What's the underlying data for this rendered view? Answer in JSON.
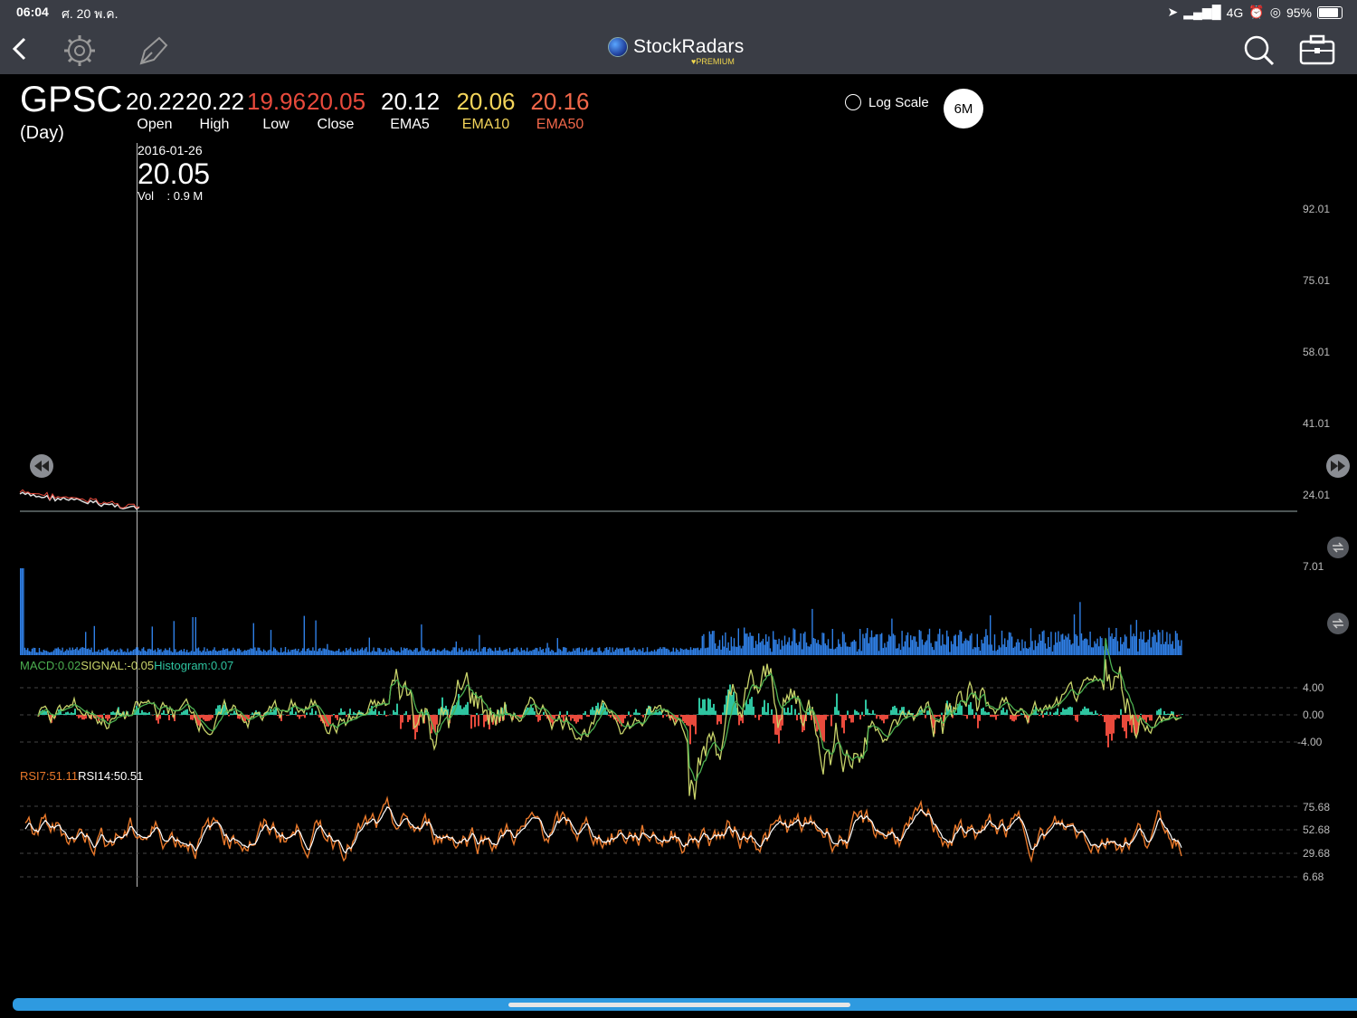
{
  "status": {
    "time": "06:04",
    "date": "ศ. 20 พ.ค.",
    "network": "4G",
    "battery": "95%",
    "battery_level": 0.95
  },
  "nav": {
    "brand": "StockRadars",
    "brand_sub": "PREMIUM"
  },
  "header": {
    "symbol": "GPSC",
    "period": "(Day)",
    "quote": [
      {
        "value": "20.22",
        "label": "Open",
        "color": "#ffffff"
      },
      {
        "value": "20.22",
        "label": "High",
        "color": "#ffffff"
      },
      {
        "value": "19.96",
        "label": "Low",
        "color": "#e84a3c"
      },
      {
        "value": "20.05",
        "label": "Close",
        "color": "#e84a3c"
      }
    ],
    "ema": [
      {
        "value": "20.12",
        "label": "EMA5",
        "color": "#ffffff"
      },
      {
        "value": "20.06",
        "label": "EMA10",
        "color": "#f3d45a"
      },
      {
        "value": "20.16",
        "label": "EMA50",
        "color": "#f2674a"
      }
    ],
    "log_scale_label": "Log Scale",
    "range_label": "6M"
  },
  "crosshair": {
    "date": "2016-01-26",
    "price": "20.05",
    "vol": "Vol    : 0.9 M"
  },
  "price_axis": [
    "92.01",
    "75.01",
    "58.01",
    "41.01",
    "24.01",
    "7.01"
  ],
  "macd": {
    "macd_label": "MACD:0.02",
    "signal_label": "SIGNAL:-0.05",
    "hist_label": "Histogram:0.07",
    "axis": [
      "4.00",
      "0.00",
      "-4.00"
    ]
  },
  "rsi": {
    "rsi7_label": "RSI7:51.11",
    "rsi14_label": "RSI14:50.51",
    "axis": [
      "75.68",
      "52.68",
      "29.68",
      "6.68"
    ]
  },
  "colors": {
    "volume": "#2f7fe6",
    "hist_pos": "#2ec4a0",
    "hist_neg": "#e84a3c",
    "macd_line": "#c8d36a",
    "signal_line": "#4caf50",
    "rsi7": "#e8782a",
    "rsi14": "#ffffff"
  }
}
